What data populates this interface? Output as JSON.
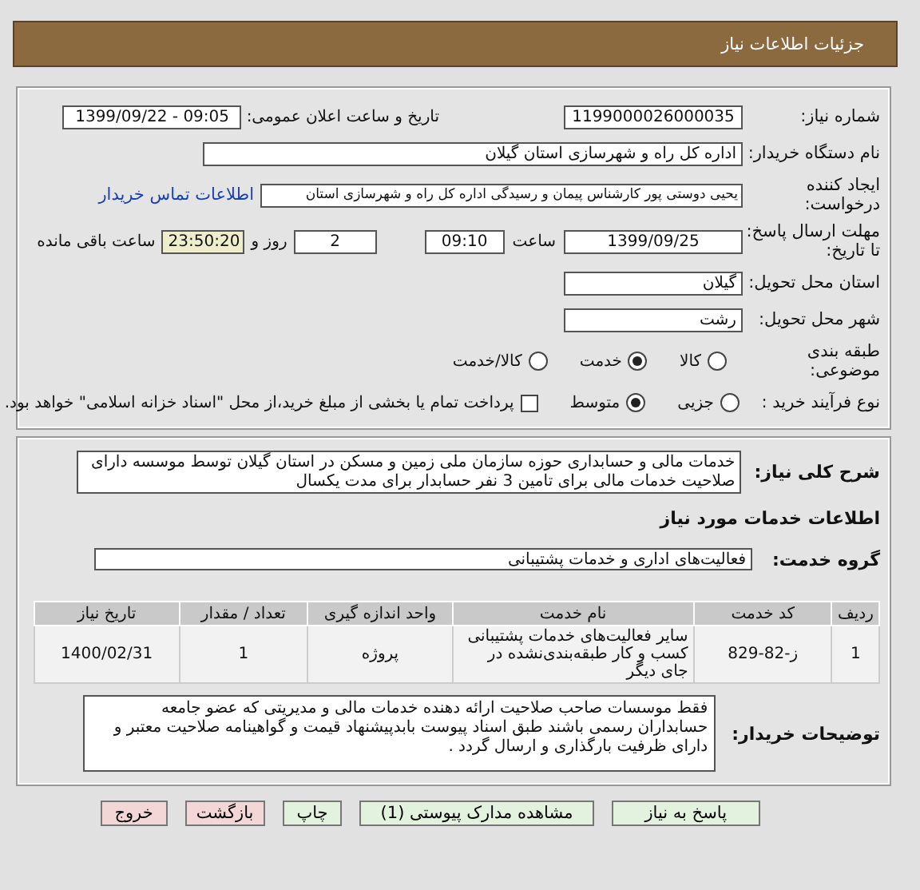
{
  "header": {
    "title": "جزئیات اطلاعات نیاز"
  },
  "need_number": {
    "label": "شماره نیاز:",
    "value": "1199000026000035"
  },
  "announce": {
    "label": "تاریخ و ساعت اعلان عمومی:",
    "value": "1399/09/22 - 09:05"
  },
  "buyer_org": {
    "label": "نام دستگاه خریدار:",
    "value": "اداره کل راه و شهرسازی استان گیلان"
  },
  "creator": {
    "label": "ایجاد کننده درخواست:",
    "value": "یحیی دوستی پور کارشناس پیمان و رسیدگی اداره کل راه و شهرسازی استان",
    "link": "اطلاعات تماس خریدار"
  },
  "deadline": {
    "label": "مهلت ارسال پاسخ: تا تاریخ:",
    "date": "1399/09/25",
    "time_label": "ساعت",
    "time": "09:10",
    "days": "2",
    "days_label": "روز و",
    "remaining": "23:50:20",
    "remaining_label": "ساعت باقی مانده"
  },
  "province": {
    "label": "استان محل تحویل:",
    "value": "گیلان"
  },
  "city": {
    "label": "شهر محل تحویل:",
    "value": "رشت"
  },
  "category": {
    "label": "طبقه بندی موضوعی:",
    "options": [
      {
        "label": "کالا",
        "selected": false
      },
      {
        "label": "خدمت",
        "selected": true
      },
      {
        "label": "کالا/خدمت",
        "selected": false
      }
    ]
  },
  "process": {
    "label": "نوع فرآیند خرید :",
    "options": [
      {
        "label": "جزیی",
        "selected": false
      },
      {
        "label": "متوسط",
        "selected": true
      }
    ],
    "payment": {
      "label": "پرداخت تمام یا بخشی از مبلغ خرید،از محل \"اسناد خزانه اسلامی\" خواهد بود.",
      "checked": false
    }
  },
  "summary": {
    "label": "شرح کلی نیاز:",
    "value": "خدمات مالی و حسابداری حوزه سازمان ملی زمین و مسکن در استان گیلان توسط موسسه دارای صلاحیت خدمات مالی برای تامین 3 نفر حسابدار برای مدت یکسال"
  },
  "services_heading": "اطلاعات خدمات مورد نیاز",
  "service_group": {
    "label": "گروه خدمت:",
    "value": "فعالیت‌های اداری و خدمات پشتیبانی"
  },
  "table": {
    "columns": [
      "ردیف",
      "کد خدمت",
      "نام خدمت",
      "واحد اندازه گیری",
      "تعداد / مقدار",
      "تاریخ نیاز"
    ],
    "rows": [
      [
        "1",
        "ز-82-829",
        "سایر فعالیت‌های خدمات پشتیبانی کسب و کار طبقه‌بندی‌نشده در جای دیگر",
        "پروژه",
        "1",
        "1400/02/31"
      ]
    ]
  },
  "notes": {
    "label": "توضیحات خریدار:",
    "value": "فقط موسسات صاحب صلاحیت ارائه دهنده خدمات مالی و مدیریتی که عضو جامعه حسابداران رسمی باشند طبق اسناد پیوست بابدپیشنهاد قیمت و گواهینامه صلاحیت معتبر و دارای ظرفیت بارگذاری و ارسال گردد ."
  },
  "buttons": [
    {
      "label": "پاسخ به نیاز",
      "kind": "normal"
    },
    {
      "label": "مشاهده مدارک پیوستی (1)",
      "kind": "normal"
    },
    {
      "label": "چاپ",
      "kind": "normal"
    },
    {
      "label": "بازگشت",
      "kind": "danger"
    },
    {
      "label": "خروج",
      "kind": "danger"
    }
  ]
}
